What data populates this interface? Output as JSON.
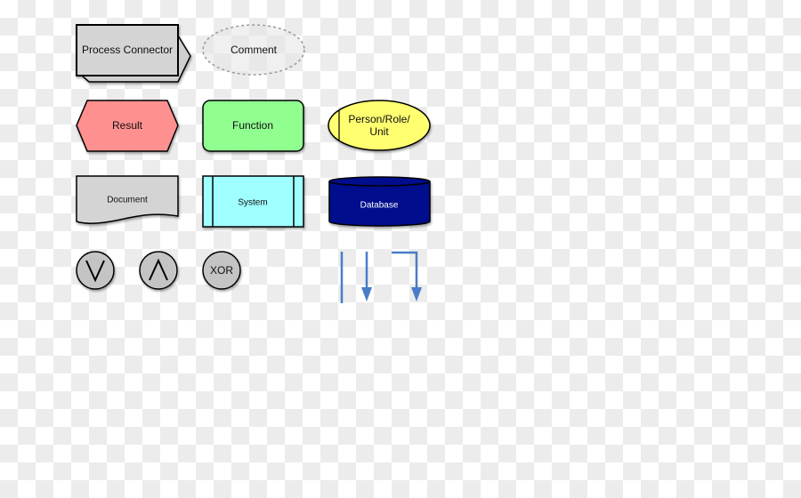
{
  "shapes": {
    "process_connector": "Process Connector",
    "comment": "Comment",
    "result": "Result",
    "function": "Function",
    "person_line1": "Person/Role/",
    "person_line2": "Unit",
    "document": "Document",
    "system": "System",
    "database": "Database",
    "or_symbol": "∨",
    "and_symbol": "∧",
    "xor": "XOR"
  },
  "colors": {
    "result": "#ff9090",
    "function": "#90ff90",
    "person": "#ffff70",
    "system": "#a0ffff",
    "database": "#00108c",
    "connector_gray": "#d0d0d0",
    "operator_gray": "#c4c4c4",
    "arrow_blue": "#4a7cc8"
  }
}
